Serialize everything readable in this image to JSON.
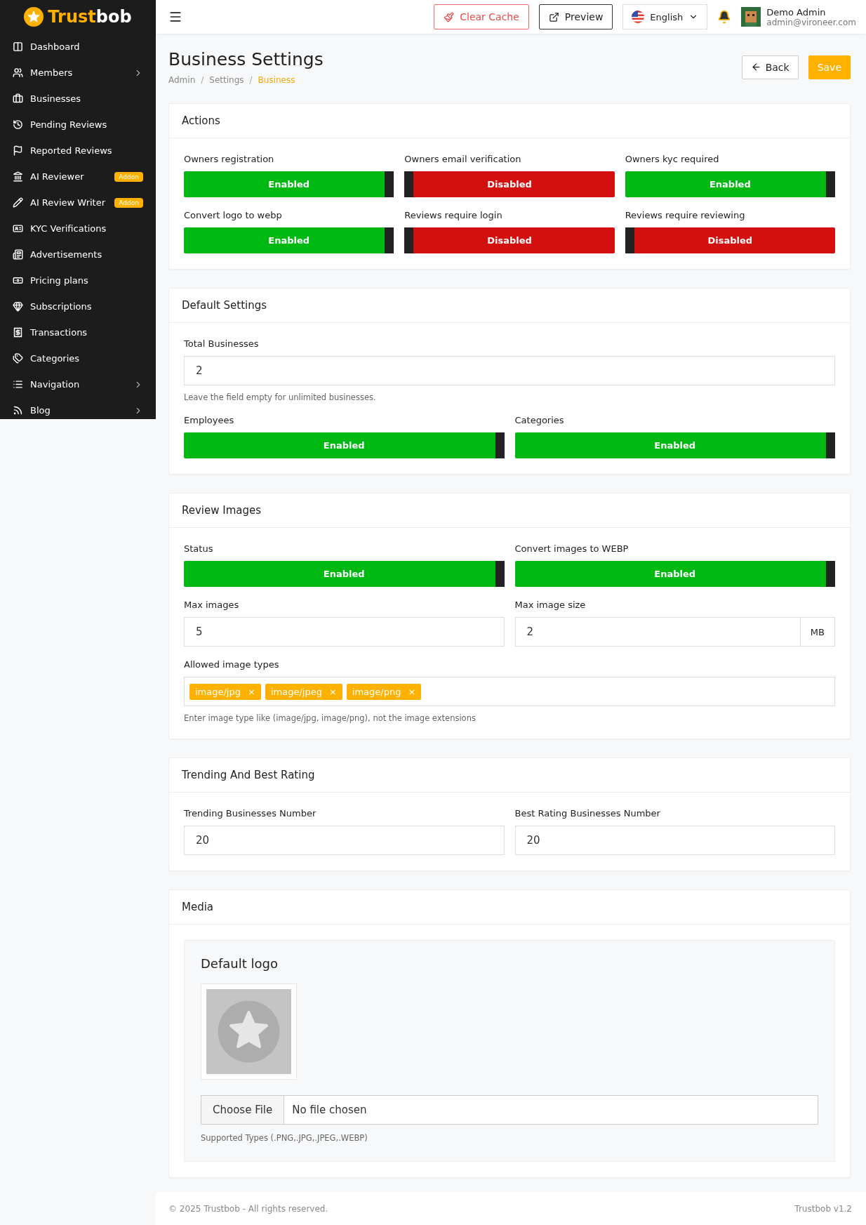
{
  "sidebar": {
    "logo": {
      "accent": "Trust",
      "rest": "bob"
    },
    "items": [
      {
        "label": "Dashboard",
        "expandable": false
      },
      {
        "label": "Members",
        "expandable": true
      },
      {
        "label": "Businesses",
        "expandable": false
      },
      {
        "label": "Pending Reviews",
        "expandable": false
      },
      {
        "label": "Reported Reviews",
        "expandable": false
      },
      {
        "label": "AI Reviewer",
        "expandable": false,
        "badge": "Addon"
      },
      {
        "label": "AI Review Writer",
        "expandable": false,
        "badge": "Addon"
      },
      {
        "label": "KYC Verifications",
        "expandable": false
      },
      {
        "label": "Advertisements",
        "expandable": false
      },
      {
        "label": "Pricing plans",
        "expandable": false
      },
      {
        "label": "Subscriptions",
        "expandable": false
      },
      {
        "label": "Transactions",
        "expandable": false
      },
      {
        "label": "Categories",
        "expandable": false
      },
      {
        "label": "Navigation",
        "expandable": true
      },
      {
        "label": "Blog",
        "expandable": true
      }
    ]
  },
  "header": {
    "buttons": [
      {
        "label": "Clear Cache",
        "kind": "danger"
      },
      {
        "label": "Preview",
        "kind": "outline"
      }
    ],
    "language": "English",
    "user": {
      "name": "Demo Admin",
      "email": "admin@vironeer.com"
    }
  },
  "page": {
    "title": "Business Settings",
    "breadcrumb_separator": "/",
    "breadcrumbs": [
      {
        "label": "Admin",
        "selected": false
      },
      {
        "label": "Settings",
        "selected": false
      },
      {
        "label": "Business",
        "selected": true
      }
    ],
    "actions": [
      {
        "label": "Back",
        "kind": "back"
      },
      {
        "label": "Save",
        "kind": "primary"
      }
    ]
  },
  "sections": [
    {
      "title": "Actions",
      "fields": [
        {
          "kind": "toggle",
          "label": "Owners registration",
          "on": true,
          "text": "Enabled"
        },
        {
          "kind": "toggle",
          "label": "Owners email verification",
          "on": false,
          "text": "Disabled"
        },
        {
          "kind": "toggle",
          "label": "Owners kyc required",
          "on": true,
          "text": "Enabled"
        },
        {
          "kind": "toggle",
          "label": "Convert logo to webp",
          "on": true,
          "text": "Enabled"
        },
        {
          "kind": "toggle",
          "label": "Reviews require login",
          "on": false,
          "text": "Disabled"
        },
        {
          "kind": "toggle",
          "label": "Reviews require reviewing",
          "on": false,
          "text": "Disabled"
        }
      ]
    },
    {
      "title": "Default Settings",
      "fields": [
        {
          "kind": "input",
          "label": "Total Businesses",
          "value": "2",
          "wide": true,
          "hint": "Leave the field empty for unlimited businesses."
        },
        {
          "kind": "toggle",
          "label": "Employees",
          "on": true,
          "text": "Enabled"
        },
        {
          "kind": "toggle",
          "label": "Categories",
          "on": true,
          "text": "Enabled"
        }
      ]
    },
    {
      "title": "Review Images",
      "fields": [
        {
          "kind": "toggle",
          "label": "Status",
          "on": true,
          "text": "Enabled"
        },
        {
          "kind": "toggle",
          "label": "Convert images to WEBP",
          "on": true,
          "text": "Enabled"
        },
        {
          "kind": "input",
          "label": "Max images",
          "value": "5"
        },
        {
          "kind": "input",
          "label": "Max image size",
          "value": "2",
          "suffix": "MB"
        },
        {
          "kind": "tags",
          "label": "Allowed image types",
          "wide": true,
          "tags": [
            {
              "label": "image/jpg",
              "remove": "×"
            },
            {
              "label": "image/jpeg",
              "remove": "×"
            },
            {
              "label": "image/png",
              "remove": "×"
            }
          ],
          "hint": "Enter image type like (image/jpg, image/png), not the image extensions"
        }
      ]
    },
    {
      "title": "Trending And Best Rating",
      "fields": [
        {
          "kind": "input",
          "label": "Trending Businesses Number",
          "value": "20"
        },
        {
          "kind": "input",
          "label": "Best Rating Businesses Number",
          "value": "20"
        }
      ]
    },
    {
      "title": "Media",
      "fields": [
        {
          "kind": "logo",
          "label": "Default logo",
          "button": "Choose File",
          "file": "No file chosen",
          "hint": "Supported Types (.PNG,.JPG,.JPEG,.WEBP)"
        }
      ]
    }
  ],
  "footer": {
    "copyright": "© 2025 Trustbob - All rights reserved.",
    "version": "Trustbob v1.2"
  }
}
